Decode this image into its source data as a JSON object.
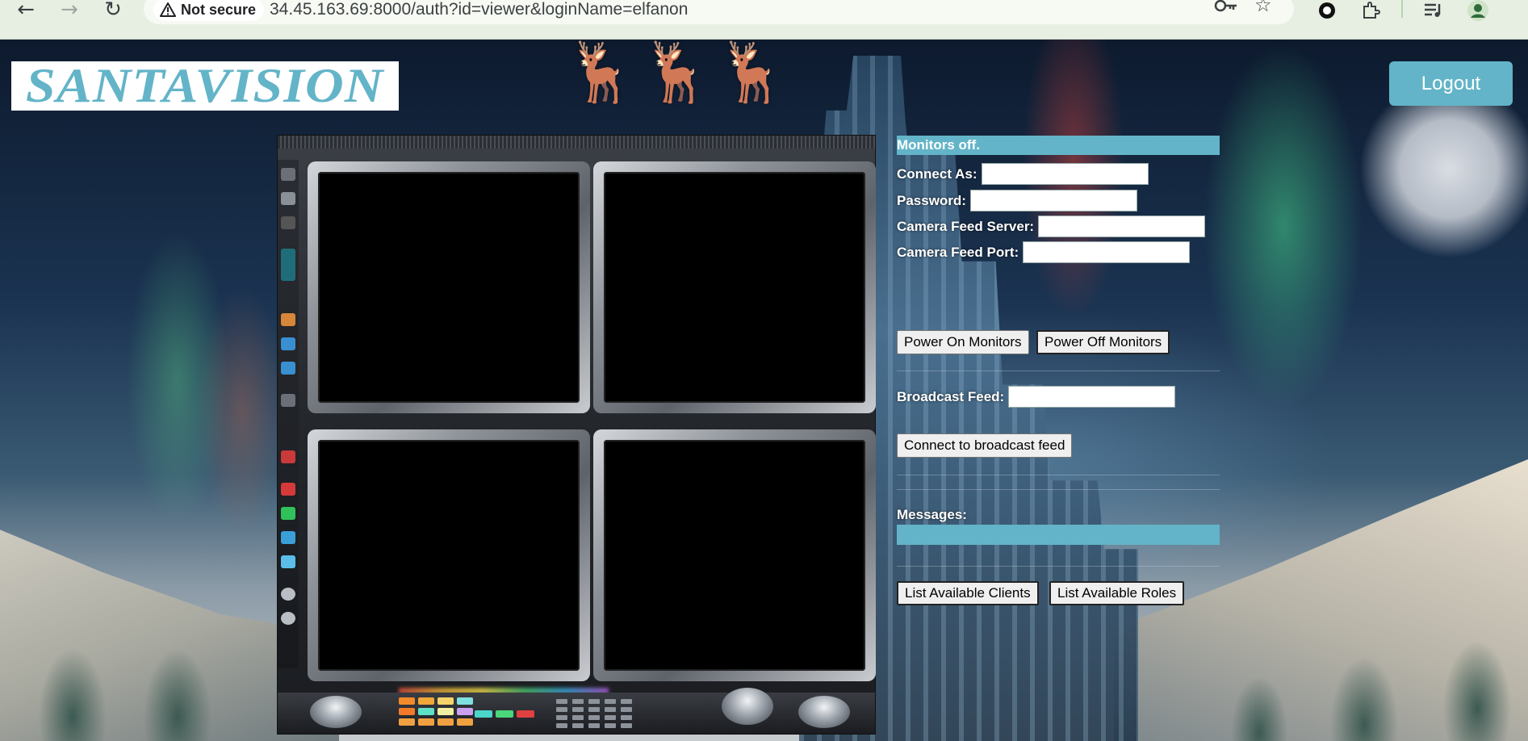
{
  "browser": {
    "nav": {
      "back": "←",
      "forward": "→",
      "reload": "↻"
    },
    "security_label": "Not secure",
    "url": "34.45.163.69:8000/auth?id=viewer&loginName=elfanon",
    "icons": [
      "key-icon",
      "star-icon",
      "circle-extension-icon",
      "puzzle-extension-icon",
      "playlist-icon",
      "profile-icon"
    ]
  },
  "header": {
    "logo_text": "SANTAVISION",
    "logout_label": "Logout"
  },
  "panel": {
    "status": "Monitors off.",
    "connect_as_label": "Connect As:",
    "connect_as_value": "",
    "password_label": "Password:",
    "password_value": "",
    "server_label": "Camera Feed Server:",
    "server_value": "",
    "port_label": "Camera Feed Port:",
    "port_value": "",
    "power_on_label": "Power On Monitors",
    "power_off_label": "Power Off Monitors",
    "broadcast_label": "Broadcast Feed:",
    "broadcast_value": "",
    "connect_broadcast_label": "Connect to broadcast feed",
    "messages_label": "Messages:",
    "list_clients_label": "List Available Clients",
    "list_roles_label": "List Available Roles"
  },
  "colors": {
    "accent": "#63b4c8",
    "monitor_screen": "#000000"
  }
}
